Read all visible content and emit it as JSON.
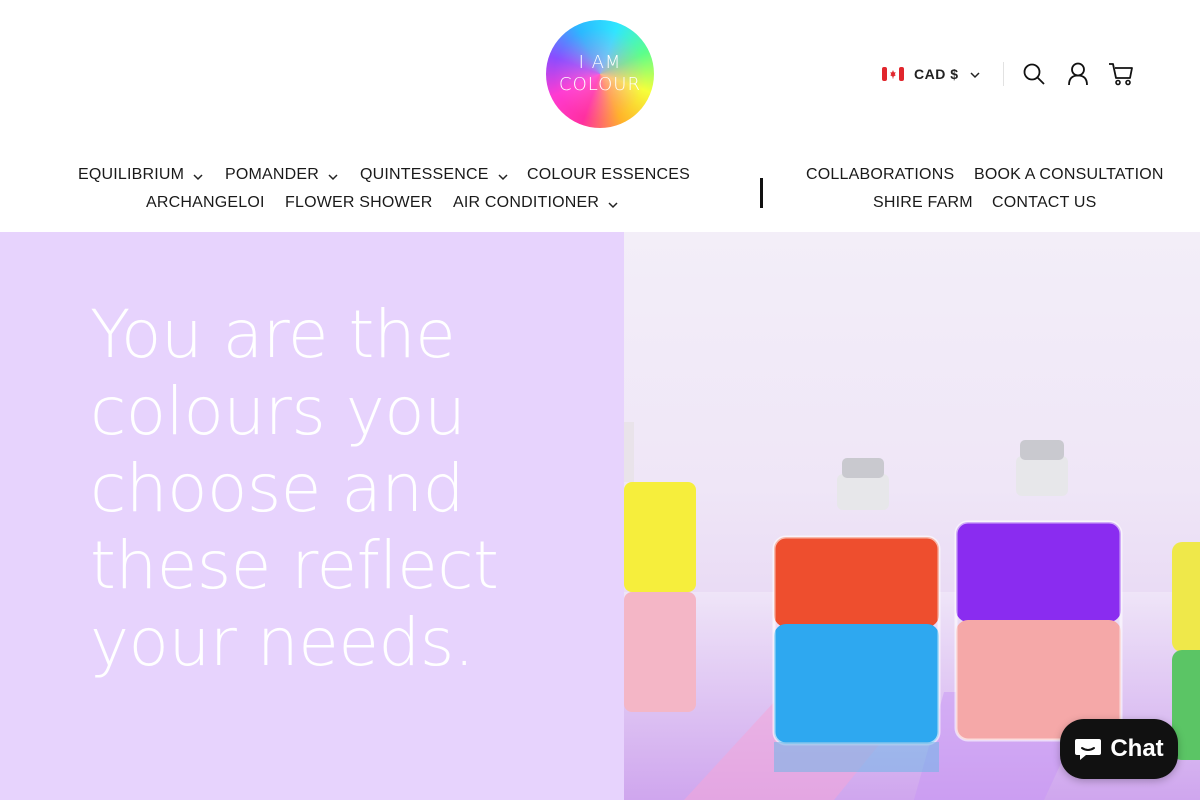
{
  "brand": {
    "logo_line1": "I AM",
    "logo_line2": "COLOUR"
  },
  "header": {
    "currency_label": "CAD $",
    "icons": [
      "search-icon",
      "account-icon",
      "cart-icon"
    ]
  },
  "nav": {
    "row1_left": [
      {
        "label": "EQUILIBRIUM",
        "has_dropdown": true
      },
      {
        "label": "POMANDER",
        "has_dropdown": true
      },
      {
        "label": "QUINTESSENCE",
        "has_dropdown": true
      },
      {
        "label": "COLOUR ESSENCES",
        "has_dropdown": false
      }
    ],
    "row2_left": [
      {
        "label": "ARCHANGELOI",
        "has_dropdown": false
      },
      {
        "label": "FLOWER SHOWER",
        "has_dropdown": false
      },
      {
        "label": "AIR CONDITIONER",
        "has_dropdown": true
      }
    ],
    "separator": "|",
    "row1_right": [
      {
        "label": "COLLABORATIONS"
      },
      {
        "label": "BOOK A CONSULTATION"
      }
    ],
    "row2_right": [
      {
        "label": "SHIRE FARM"
      },
      {
        "label": "CONTACT US"
      }
    ]
  },
  "hero": {
    "headline_lines": [
      "You are the",
      "colours you",
      "choose and",
      "these reflect",
      "your needs."
    ],
    "background_color": "#e7d3fd"
  },
  "chat": {
    "label": "Chat"
  },
  "colors": {
    "text": "#1a1a1a",
    "chat_bg": "#111111",
    "hero_bg": "#e7d3fd"
  }
}
